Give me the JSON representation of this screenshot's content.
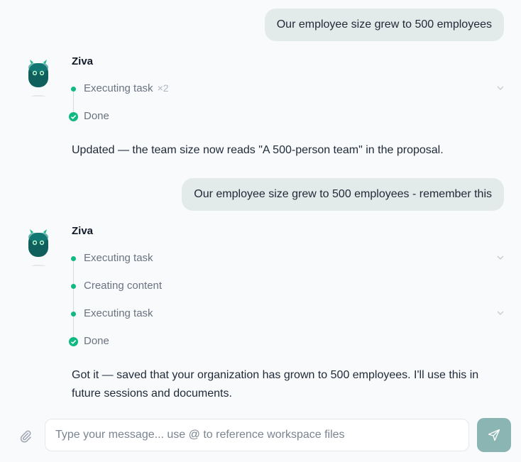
{
  "conversation": {
    "messages": [
      {
        "role": "user",
        "text": "Our employee size grew to 500 employees"
      },
      {
        "role": "assistant",
        "name": "Ziva",
        "steps": [
          {
            "label": "Executing task",
            "count": "×2",
            "status": "running"
          },
          {
            "label": "Done",
            "status": "done"
          }
        ],
        "reply": "Updated — the team size now reads \"A 500-person team\" in the proposal."
      },
      {
        "role": "user",
        "text": "Our employee size grew to 500 employees - remember this"
      },
      {
        "role": "assistant",
        "name": "Ziva",
        "steps": [
          {
            "label": "Executing task",
            "status": "running"
          },
          {
            "label": "Creating content",
            "status": "running"
          },
          {
            "label": "Executing task",
            "status": "running"
          },
          {
            "label": "Done",
            "status": "done"
          }
        ],
        "reply": "Got it — saved that your organization has grown to 500 employees. I'll use this in future sessions and documents."
      }
    ]
  },
  "composer": {
    "placeholder": "Type your message... use @ to reference workspace files",
    "value": ""
  },
  "icons": {
    "attach": "paperclip-icon",
    "send": "send-icon",
    "expand": "chevron-down-icon",
    "done": "check-circle-icon",
    "avatar": "robot-avatar-icon"
  },
  "colors": {
    "accent": "#10b981",
    "user_bubble": "#e3eaea",
    "send_button": "#8bb5b3",
    "avatar": "#0f5f5c"
  }
}
